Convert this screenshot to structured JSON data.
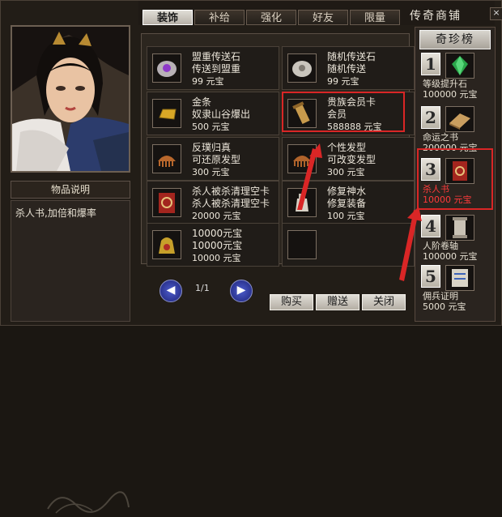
{
  "window": {
    "shop_title": "传奇商铺",
    "close_glyph": "×"
  },
  "tabs": [
    {
      "label": "装饰",
      "active": true
    },
    {
      "label": "补给",
      "active": false
    },
    {
      "label": "强化",
      "active": false
    },
    {
      "label": "好友",
      "active": false
    },
    {
      "label": "限量",
      "active": false
    }
  ],
  "description": {
    "header": "物品说明",
    "text": "杀人书,加倍和爆率"
  },
  "items": [
    {
      "name": "盟重传送石",
      "desc": "传送到盟重",
      "price": "99 元宝",
      "icon": "purple-stone-icon"
    },
    {
      "name": "随机传送石",
      "desc": "随机传送",
      "price": "99 元宝",
      "icon": "stone-icon"
    },
    {
      "name": "金条",
      "desc": "奴隶山谷爆出",
      "price": "500 元宝",
      "icon": "gold-bar-icon"
    },
    {
      "name": "贵族会员卡",
      "desc": "会员",
      "price": "588888 元宝",
      "icon": "scroll-icon"
    },
    {
      "name": "反璞归真",
      "desc": "可还原发型",
      "price": "300 元宝",
      "icon": "comb-icon"
    },
    {
      "name": "个性发型",
      "desc": "可改变发型",
      "price": "300 元宝",
      "icon": "comb-icon"
    },
    {
      "name": "杀人被杀清理空卡",
      "desc": "杀人被杀清理空卡",
      "price": "20000 元宝",
      "icon": "red-book-icon"
    },
    {
      "name": "修复神水",
      "desc": "修复装备",
      "price": "100 元宝",
      "icon": "potion-icon"
    },
    {
      "name": "10000元宝",
      "desc": "10000元宝",
      "price": "10000 元宝",
      "icon": "treasure-bag-icon"
    }
  ],
  "pager": {
    "text": "1/1",
    "prev_glyph": "◀",
    "next_glyph": "▶"
  },
  "buttons": {
    "buy": "购买",
    "gift": "赠送",
    "close": "关闭"
  },
  "rank": {
    "title": "奇珍榜",
    "items": [
      {
        "num": "1",
        "name": "等级提升石",
        "price": "100000 元宝",
        "icon": "green-gem-icon",
        "highlight": false
      },
      {
        "num": "2",
        "name": "命运之书",
        "price": "200000 元宝",
        "icon": "book-icon",
        "highlight": false
      },
      {
        "num": "3",
        "name": "杀人书",
        "price": "10000 元宝",
        "icon": "red-book-icon",
        "highlight": true
      },
      {
        "num": "4",
        "name": "人阶卷轴",
        "price": "100000 元宝",
        "icon": "scroll-icon",
        "highlight": false
      },
      {
        "num": "5",
        "name": "佣兵证明",
        "price": "5000 元宝",
        "icon": "certificate-icon",
        "highlight": false
      }
    ]
  },
  "colors": {
    "highlight": "#d92626",
    "rank_highlight_text": "#ff3a3a"
  }
}
